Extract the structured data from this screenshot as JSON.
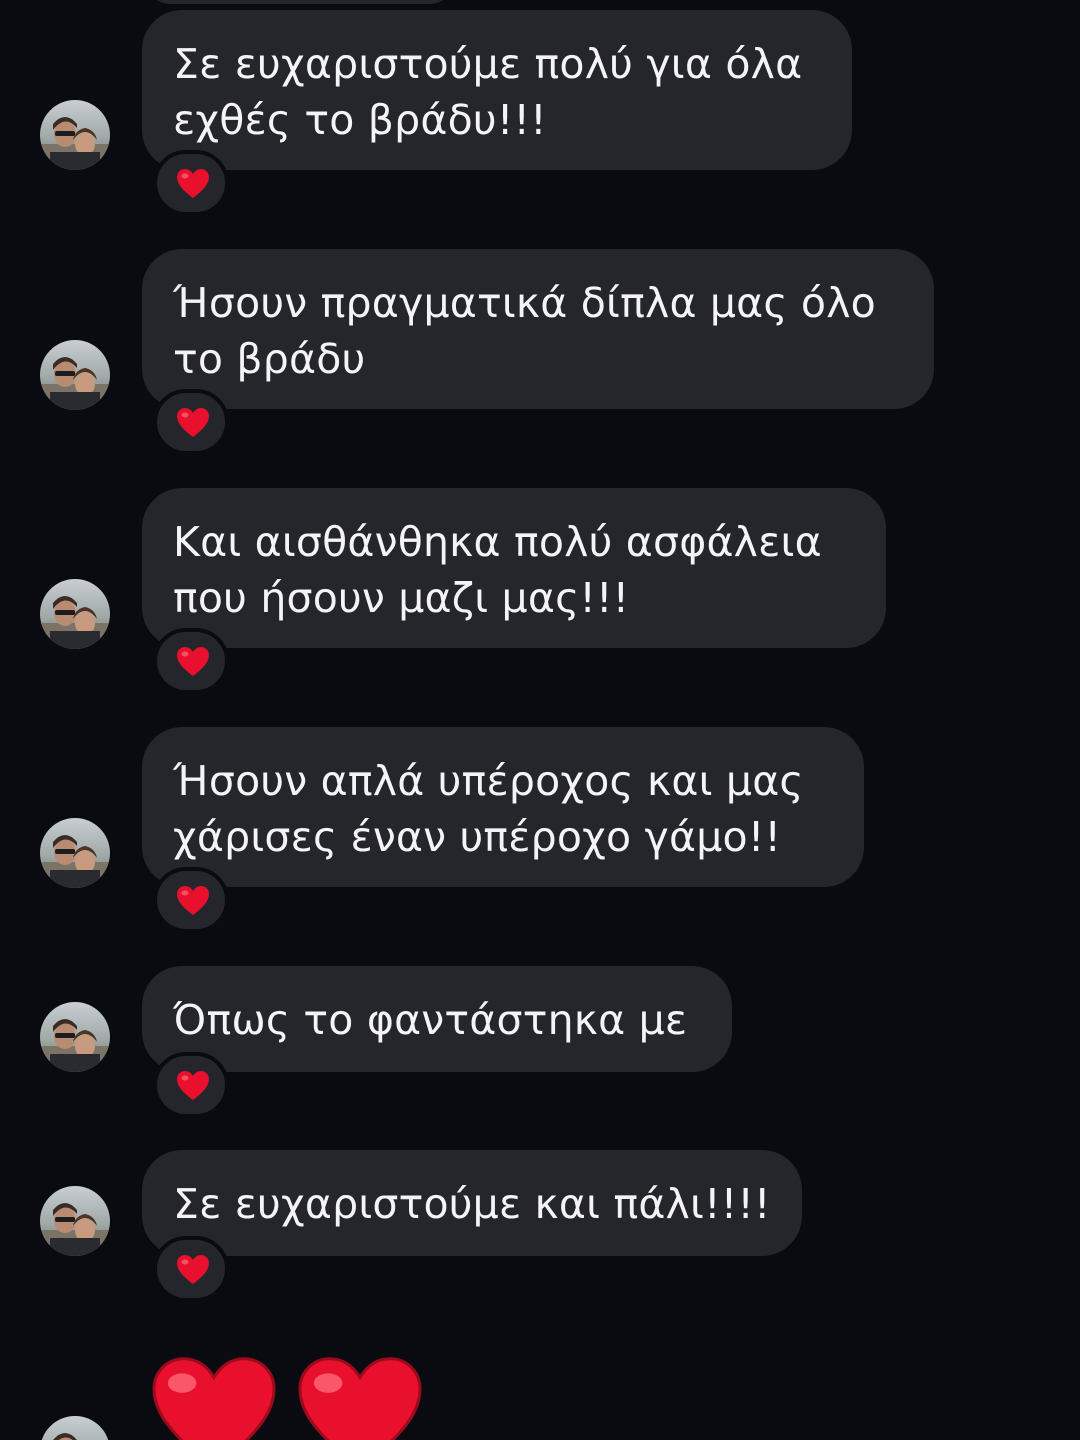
{
  "messages": [
    {
      "text": "Σε ευχαριστούμε πολύ για όλα\nεχθές το βράδυ!!!",
      "reaction": "heart-emoji"
    },
    {
      "text": "Ήσουν πραγματικά δίπλα μας όλο\nτο βράδυ",
      "reaction": "heart-emoji"
    },
    {
      "text": "Και αισθάνθηκα πολύ ασφάλεια\nπου ήσουν μαζι μας!!!",
      "reaction": "heart-emoji"
    },
    {
      "text": "Ήσουν απλά υπέροχος και μας\nχάρισες έναν υπέροχο γάμο!!",
      "reaction": "heart-emoji"
    },
    {
      "text": "Όπως το φαντάστηκα με",
      "reaction": "heart-emoji"
    },
    {
      "text": "Σε ευχαριστούμε και πάλι!!!!",
      "reaction": "heart-emoji"
    }
  ],
  "last_message": {
    "emojis": [
      "heart-emoji",
      "heart-emoji"
    ]
  },
  "colors": {
    "background": "#0a0b10",
    "bubble": "#25262b",
    "text": "#f4f4f6",
    "heart": "#e8102c"
  }
}
